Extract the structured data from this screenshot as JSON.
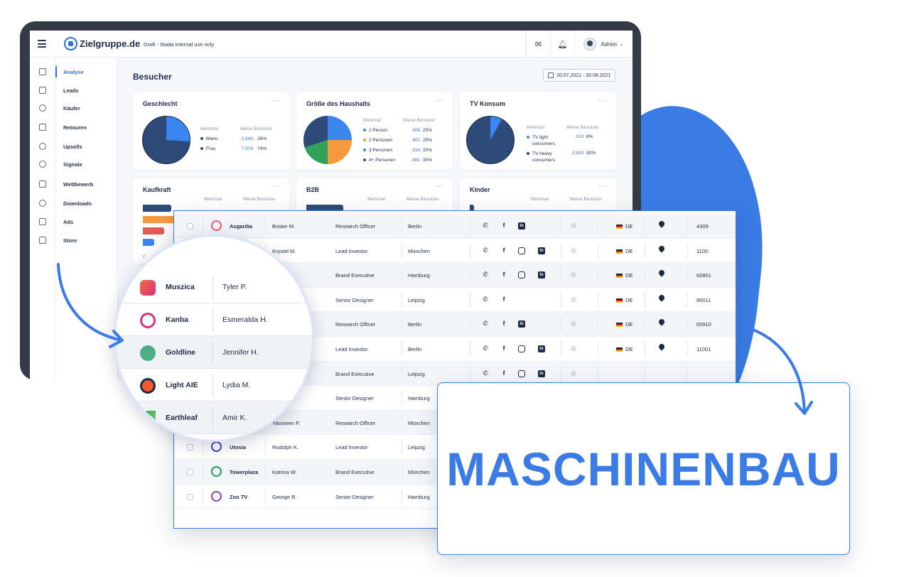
{
  "app": {
    "logo_text": "Zielgruppe.de",
    "draft_note": "Draft - Stada internal use only",
    "user": "Admin",
    "page_title": "Besucher",
    "date_range": "20.07.2021 - 20.08.2021"
  },
  "sidebar": {
    "items": [
      {
        "label": "Analyse",
        "icon": "analytics-icon"
      },
      {
        "label": "Leads",
        "icon": "bar-chart-icon"
      },
      {
        "label": "Käufer",
        "icon": "user-circle-icon"
      },
      {
        "label": "Retouren",
        "icon": "return-icon"
      },
      {
        "label": "Upsells",
        "icon": "cloud-up-icon"
      },
      {
        "label": "Signale",
        "icon": "signal-icon"
      },
      {
        "label": "Wettbewerb",
        "icon": "clipboard-icon"
      },
      {
        "label": "Downloads",
        "icon": "download-icon"
      },
      {
        "label": "Ads",
        "icon": "ad-icon"
      },
      {
        "label": "Store",
        "icon": "store-icon"
      }
    ]
  },
  "cards": {
    "more": "···",
    "legend_header": {
      "feature": "Merkmal",
      "users": "Meine Benutzer"
    },
    "geschlecht": {
      "title": "Geschlecht",
      "rows": [
        {
          "label": "Mann",
          "value": "2.843",
          "pct": "26%"
        },
        {
          "label": "Frau",
          "value": "7.974",
          "pct": "74%"
        }
      ]
    },
    "haushalt": {
      "title": "Größe des Haushalts",
      "rows": [
        {
          "label": "1 Person",
          "value": "408",
          "pct": "25%"
        },
        {
          "label": "2 Personen",
          "value": "401",
          "pct": "25%"
        },
        {
          "label": "3 Personen",
          "value": "314",
          "pct": "20%"
        },
        {
          "label": "4+ Personen",
          "value": "481",
          "pct": "30%"
        }
      ]
    },
    "tv": {
      "title": "TV Konsum",
      "rows": [
        {
          "label": "TV light consumers",
          "value": "319",
          "pct": "8%"
        },
        {
          "label": "TV heavy consumers",
          "value": "3.933",
          "pct": "92%"
        }
      ]
    },
    "kaufkraft": {
      "title": "Kaufkraft",
      "axis": [
        "0",
        "10",
        "1"
      ]
    },
    "b2b": {
      "title": "B2B"
    },
    "kinder": {
      "title": "Kinder"
    }
  },
  "colors": {
    "navy": "#2d4a78",
    "blue": "#3a86ee",
    "orange": "#f59a3c",
    "green": "#2fa15a",
    "red": "#e05a5a",
    "accent": "#3a7be6"
  },
  "table": {
    "rows": [
      {
        "company": "Asgardia",
        "person": "Buster M.",
        "role": "Research Officer",
        "city": "Berlin",
        "cc": "DE",
        "code": "4309"
      },
      {
        "company": "",
        "person": "Krystel M.",
        "role": "Lead Investor",
        "city": "München",
        "cc": "DE",
        "code": "1100"
      },
      {
        "company": "",
        "person": "",
        "role": "Brand Executive",
        "city": "Hamburg",
        "cc": "DE",
        "code": "82801"
      },
      {
        "company": "",
        "person": "",
        "role": "Senior Designer",
        "city": "Leipzig",
        "cc": "DE",
        "code": "90011"
      },
      {
        "company": "",
        "person": "",
        "role": "Research Officer",
        "city": "Berlin",
        "cc": "DE",
        "code": "00910"
      },
      {
        "company": "",
        "person": "",
        "role": "Lead Investor",
        "city": "Berlin",
        "cc": "DE",
        "code": "11001"
      },
      {
        "company": "",
        "person": "",
        "role": "Brand Executive",
        "city": "Leipzig",
        "cc": "",
        "code": ""
      },
      {
        "company": "",
        "person": "",
        "role": "Senior Designer",
        "city": "Hamburg",
        "cc": "",
        "code": ""
      },
      {
        "company": "",
        "person": "Yasmeen P.",
        "role": "Research Officer",
        "city": "München",
        "cc": "",
        "code": ""
      },
      {
        "company": "Utosia",
        "person": "Rudolph K.",
        "role": "Lead Investor",
        "city": "Leipzig",
        "cc": "",
        "code": ""
      },
      {
        "company": "Towerplaza",
        "person": "Katrina W.",
        "role": "Brand Executive",
        "city": "München",
        "cc": "",
        "code": ""
      },
      {
        "company": "Zoo TV",
        "person": "George R.",
        "role": "Senior Designer",
        "city": "Hamburg",
        "cc": "",
        "code": ""
      }
    ]
  },
  "magnifier": {
    "rows": [
      {
        "company": "Muszica",
        "person": "Tyler P."
      },
      {
        "company": "Kanba",
        "person": "Esmeralda H."
      },
      {
        "company": "Goldline",
        "person": "Jennifer H."
      },
      {
        "company": "Light AIE",
        "person": "Lydia M."
      },
      {
        "company": "Earthleaf",
        "person": "Amir K."
      }
    ]
  },
  "callout": {
    "text": "MASCHINENBAU"
  }
}
